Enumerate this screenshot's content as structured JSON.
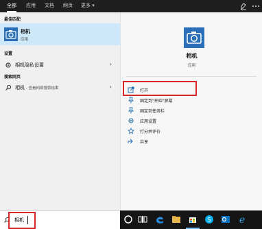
{
  "tabs": [
    "全部",
    "应用",
    "文档",
    "网页",
    "更多 ▾"
  ],
  "colors": {
    "accent": "#0078d7",
    "highlight": "#cde8fb",
    "annotation": "#d62828"
  },
  "left": {
    "best_match_heading": "最佳匹配",
    "best_match": {
      "name": "相机",
      "type": "应用",
      "icon": "camera-icon"
    },
    "settings_heading": "设置",
    "settings_item": "相机隐私设置",
    "web_heading": "搜索网页",
    "web_item": "相机",
    "web_item_suffix": " - 查看网络搜索结果"
  },
  "right": {
    "app_name": "相机",
    "app_type": "应用",
    "actions": [
      {
        "label": "打开",
        "icon": "open-icon"
      },
      {
        "label": "固定到\"开始\"屏幕",
        "icon": "pin-start-icon"
      },
      {
        "label": "固定到任务栏",
        "icon": "pin-taskbar-icon"
      },
      {
        "label": "应用设置",
        "icon": "gear-icon"
      },
      {
        "label": "打分并评价",
        "icon": "star-icon"
      },
      {
        "label": "共享",
        "icon": "share-icon"
      }
    ]
  },
  "search": {
    "value": "相机"
  }
}
